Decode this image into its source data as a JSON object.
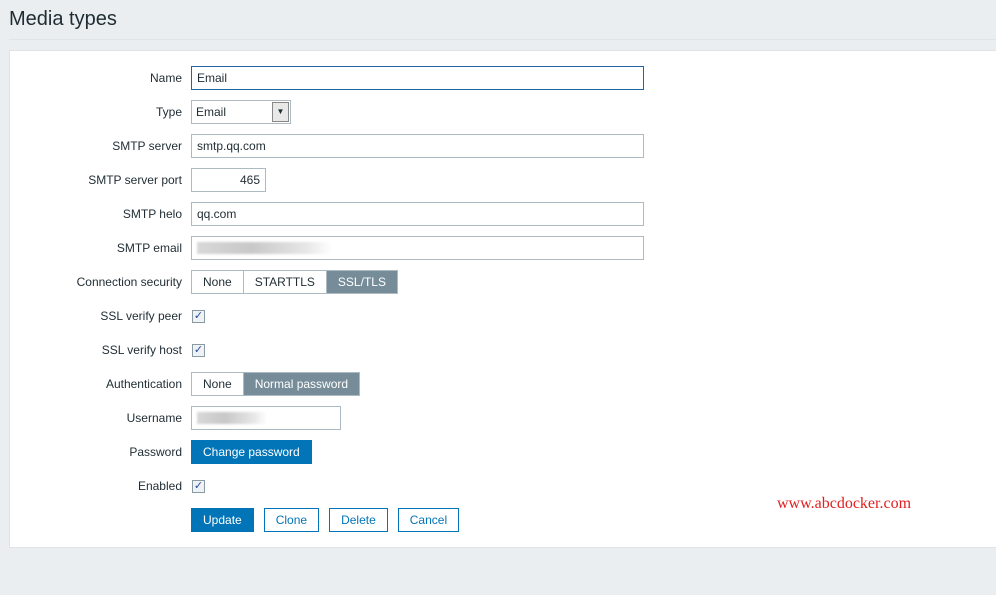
{
  "page": {
    "title": "Media types"
  },
  "form": {
    "name": {
      "label": "Name",
      "value": "Email"
    },
    "type": {
      "label": "Type",
      "value": "Email"
    },
    "smtp_server": {
      "label": "SMTP server",
      "value": "smtp.qq.com"
    },
    "smtp_port": {
      "label": "SMTP server port",
      "value": "465"
    },
    "smtp_helo": {
      "label": "SMTP helo",
      "value": "qq.com"
    },
    "smtp_email": {
      "label": "SMTP email"
    },
    "connection_security": {
      "label": "Connection security",
      "options": [
        "None",
        "STARTTLS",
        "SSL/TLS"
      ],
      "selected": "SSL/TLS"
    },
    "ssl_verify_peer": {
      "label": "SSL verify peer",
      "checked": true
    },
    "ssl_verify_host": {
      "label": "SSL verify host",
      "checked": true
    },
    "authentication": {
      "label": "Authentication",
      "options": [
        "None",
        "Normal password"
      ],
      "selected": "Normal password"
    },
    "username": {
      "label": "Username"
    },
    "password": {
      "label": "Password",
      "button": "Change password"
    },
    "enabled": {
      "label": "Enabled",
      "checked": true
    }
  },
  "actions": {
    "update": "Update",
    "clone": "Clone",
    "delete": "Delete",
    "cancel": "Cancel"
  },
  "watermark": "www.abcdocker.com",
  "colors": {
    "accent": "#0275b8",
    "selected_segment": "#768d99"
  }
}
